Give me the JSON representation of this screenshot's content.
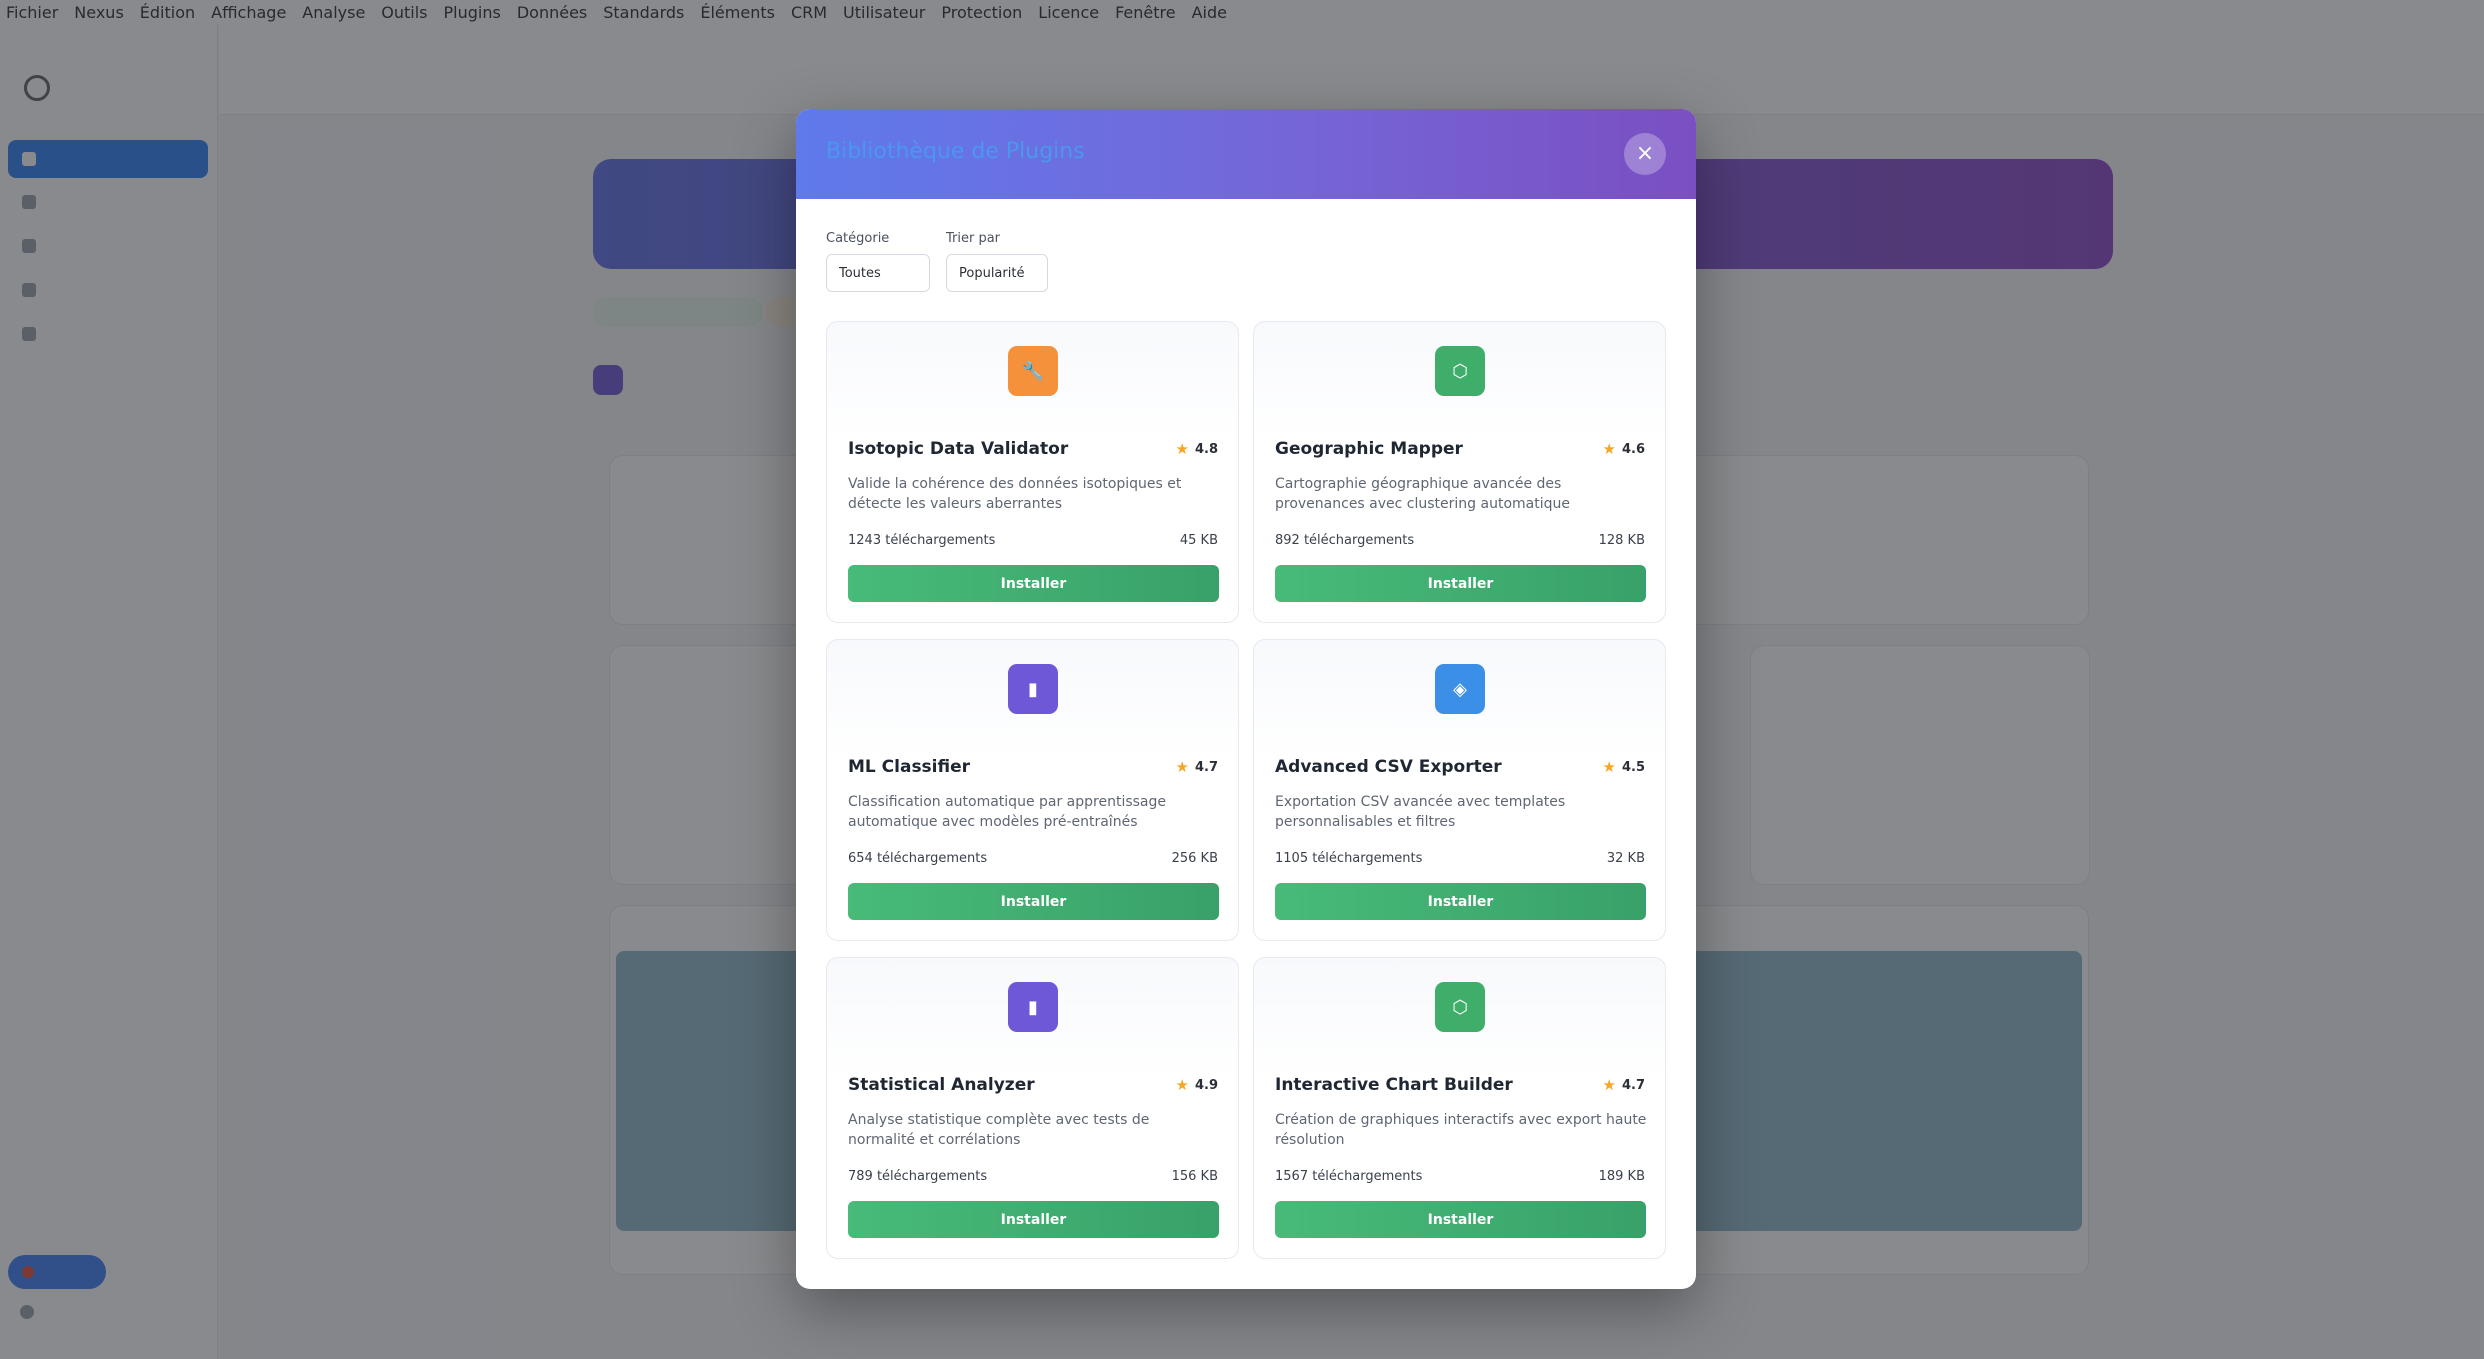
{
  "menubar": [
    "Fichier",
    "Nexus",
    "Édition",
    "Affichage",
    "Analyse",
    "Outils",
    "Plugins",
    "Données",
    "Standards",
    "Éléments",
    "CRM",
    "Utilisateur",
    "Protection",
    "Licence",
    "Fenêtre",
    "Aide"
  ],
  "modal": {
    "title": "Bibliothèque de Plugins",
    "close_glyph": "×",
    "filters": {
      "category_label": "Catégorie",
      "category_value": "Toutes",
      "sort_label": "Trier par",
      "sort_value": "Popularité"
    },
    "plugins": [
      {
        "name": "Isotopic Data Validator",
        "rating": "4.8",
        "description": "Valide la cohérence des données isotopiques et détecte les valeurs aberrantes",
        "downloads": "1243 téléchargements",
        "size": "45 KB",
        "button": "Installer",
        "icon": "wrench-icon",
        "color": "#f4913a"
      },
      {
        "name": "Geographic Mapper",
        "rating": "4.6",
        "description": "Cartographie géographique avancée des provenances avec clustering automatique",
        "downloads": "892 téléchargements",
        "size": "128 KB",
        "button": "Installer",
        "icon": "hexagon-icon",
        "color": "#3fae6a"
      },
      {
        "name": "ML Classifier",
        "rating": "4.7",
        "description": "Classification automatique par apprentissage automatique avec modèles pré-entraînés",
        "downloads": "654 téléchargements",
        "size": "256 KB",
        "button": "Installer",
        "icon": "bar-chart-icon",
        "color": "#6e58d8"
      },
      {
        "name": "Advanced CSV Exporter",
        "rating": "4.5",
        "description": "Exportation CSV avancée avec templates personnalisables et filtres",
        "downloads": "1105 téléchargements",
        "size": "32 KB",
        "button": "Installer",
        "icon": "cube-icon",
        "color": "#3b8fe6"
      },
      {
        "name": "Statistical Analyzer",
        "rating": "4.9",
        "description": "Analyse statistique complète avec tests de normalité et corrélations",
        "downloads": "789 téléchargements",
        "size": "156 KB",
        "button": "Installer",
        "icon": "bar-chart-icon",
        "color": "#6e58d8"
      },
      {
        "name": "Interactive Chart Builder",
        "rating": "4.7",
        "description": "Création de graphiques interactifs avec export haute résolution",
        "downloads": "1567 téléchargements",
        "size": "189 KB",
        "button": "Installer",
        "icon": "hexagon-icon",
        "color": "#3fae6a"
      }
    ]
  }
}
